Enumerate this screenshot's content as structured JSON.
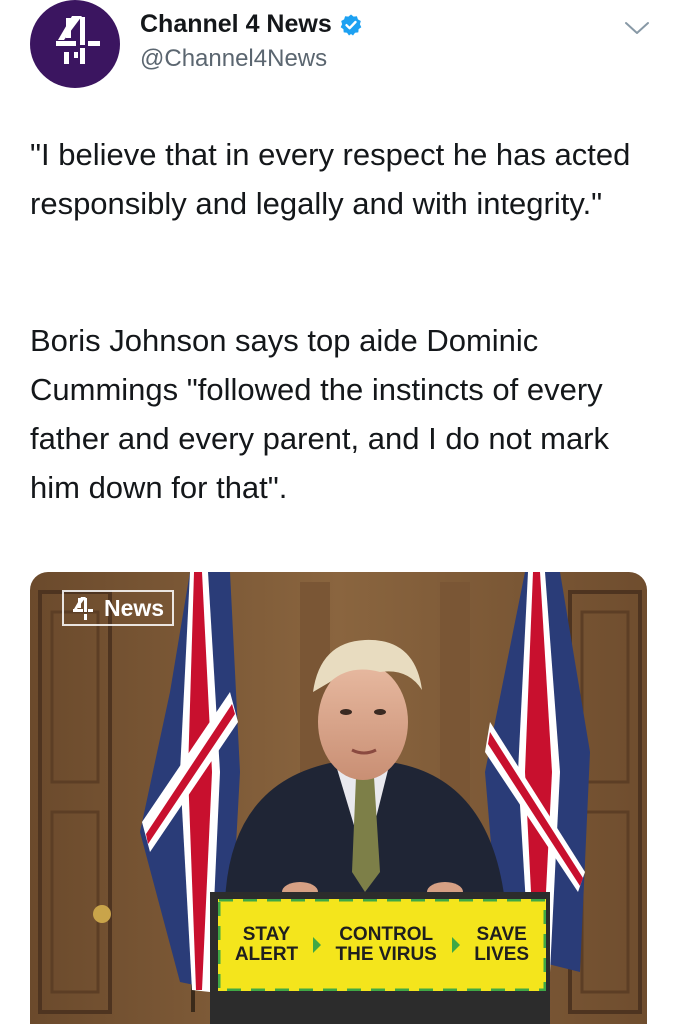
{
  "header": {
    "display_name": "Channel 4 News",
    "handle": "@Channel4News",
    "avatar_icon": "channel-4-logo-icon",
    "verified_icon": "verified-badge-icon",
    "menu_icon": "chevron-down-icon"
  },
  "tweet": {
    "paragraph_1": "\"I believe that in every respect he has acted responsibly and legally and with integrity.\"",
    "paragraph_2": "Boris Johnson says top aide Dominic Cummings \"followed the instincts of every father and every parent, and I do not mark him down for that\"."
  },
  "media": {
    "bug_label": "News",
    "sign": {
      "line_1a": "STAY",
      "line_1b": "ALERT",
      "line_2a": "CONTROL",
      "line_2b": "THE VIRUS",
      "line_3a": "SAVE",
      "line_3b": "LIVES"
    }
  },
  "colors": {
    "avatar_bg": "#3b1560",
    "verified_blue": "#1da1f2",
    "sign_yellow": "#f4e51c",
    "sign_green": "#3fa845"
  }
}
